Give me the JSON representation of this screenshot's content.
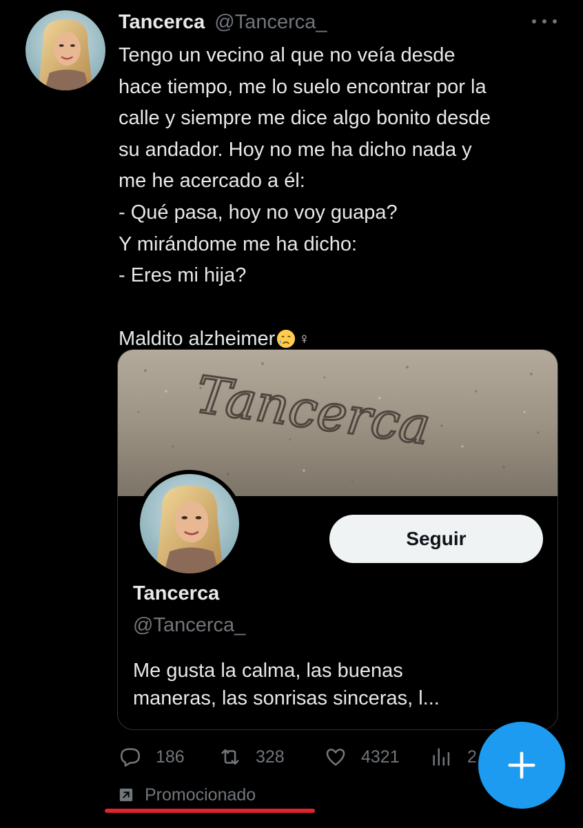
{
  "tweet": {
    "author_name": "Tancerca",
    "author_handle": "@Tancerca_",
    "lines": [
      "Tengo un vecino al que no veía desde",
      "hace tiempo, me lo suelo encontrar por la",
      "calle y siempre me dice algo bonito desde",
      "su andador. Hoy no me ha dicho nada y",
      "me he acercado a él:",
      "- Qué pasa, hoy no voy guapa?",
      "Y mirándome me ha dicho:",
      "- Eres mi hija?"
    ],
    "last_line": "Maldito alzheimer",
    "last_line_emoji_female": "♀",
    "icons": {
      "more": "more-options-icon",
      "sad_emoji": "sad-relieved-face-icon"
    }
  },
  "card": {
    "banner_text": "Tancerca",
    "follow_label": "Seguir",
    "name": "Tancerca",
    "handle": "@Tancerca_",
    "bio_line1": "Me gusta la calma, las buenas",
    "bio_line2": "maneras, las sonrisas sinceras, l..."
  },
  "actions": {
    "replies": "186",
    "retweets": "328",
    "likes": "4321",
    "views": "2",
    "icons": [
      "reply-icon",
      "retweet-icon",
      "like-icon",
      "views-icon"
    ]
  },
  "promoted_label": "Promocionado",
  "colors": {
    "background": "#000000",
    "text": "#e7e9ea",
    "secondary": "#71767b",
    "accent": "#1d9bf0",
    "underline": "#e0242f"
  }
}
